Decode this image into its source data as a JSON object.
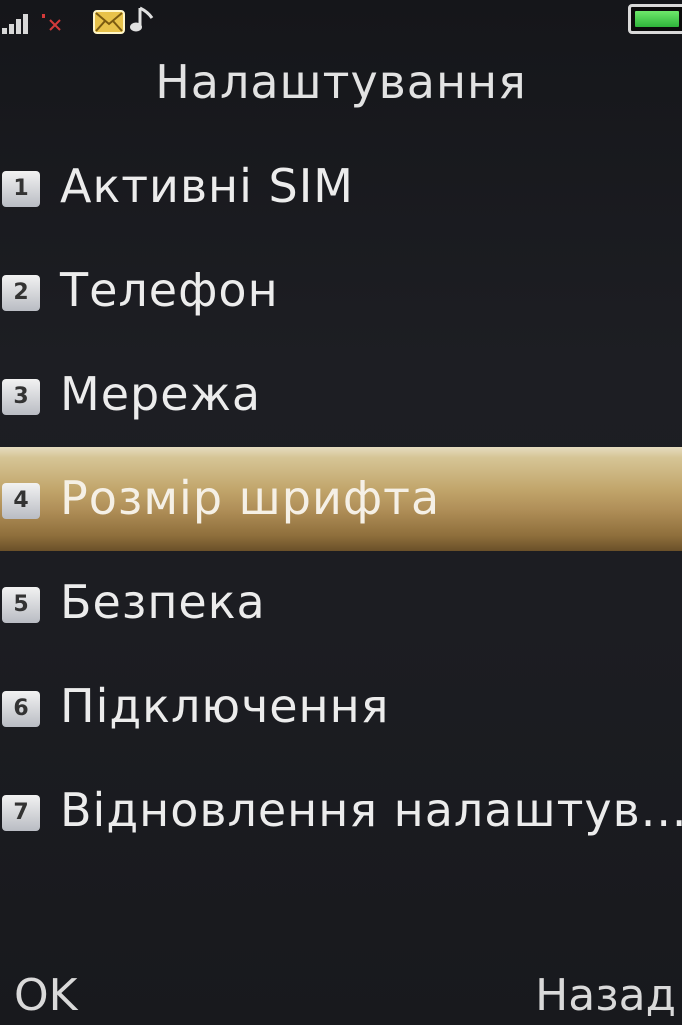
{
  "status_bar": {
    "icons": [
      "signal-icon",
      "no-signal-icon",
      "mail-icon",
      "music-icon",
      "battery-icon"
    ],
    "battery_level": 1.0,
    "colors": {
      "signal": "#d8d8d8",
      "no_signal": "#d43a3a",
      "mail": "#e8c24a",
      "battery": "#3cc84a"
    }
  },
  "header": {
    "title": "Налаштування"
  },
  "menu": {
    "selected_index": 3,
    "highlight_color": "#c2a66c",
    "items": [
      {
        "num": "1",
        "label": "Активні SIM"
      },
      {
        "num": "2",
        "label": "Телефон"
      },
      {
        "num": "3",
        "label": "Мережа"
      },
      {
        "num": "4",
        "label": "Розмір шрифта"
      },
      {
        "num": "5",
        "label": "Безпека"
      },
      {
        "num": "6",
        "label": "Підключення"
      },
      {
        "num": "7",
        "label": "Відновлення налаштув..."
      }
    ]
  },
  "softkeys": {
    "left": "OK",
    "right": "Назад"
  }
}
